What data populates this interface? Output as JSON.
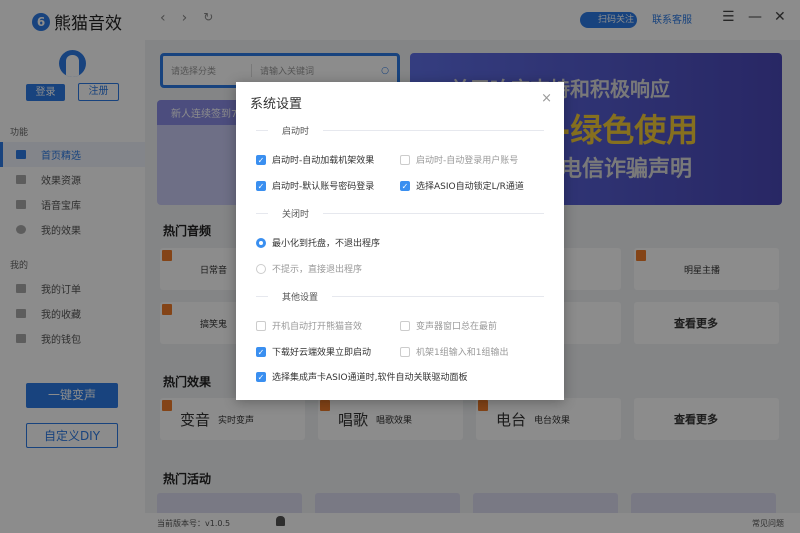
{
  "app": {
    "name": "熊猫音效",
    "logo_glyph": "6"
  },
  "topbar": {
    "back": "‹",
    "forward": "›",
    "refresh": "↻",
    "scan_follow": "扫码关注",
    "contact_service": "联系客服",
    "menu": "☰",
    "minimize": "—",
    "close": "✕"
  },
  "sidebar": {
    "login": "登录",
    "register": "注册",
    "group1": "功能",
    "items1": [
      {
        "label": "首页精选",
        "active": true
      },
      {
        "label": "效果资源"
      },
      {
        "label": "语音宝库"
      },
      {
        "label": "我的效果"
      }
    ],
    "group2": "我的",
    "items2": [
      {
        "label": "我的订单"
      },
      {
        "label": "我的收藏"
      },
      {
        "label": "我的钱包"
      }
    ],
    "one_click": "一键变声",
    "custom_diy": "自定义DIY"
  },
  "main": {
    "search": {
      "category_placeholder": "请选择分类",
      "keyword_placeholder": "请输入关键词"
    },
    "sign_banner": "新人连续签到7天",
    "banner": {
      "line1": "关于响应支持和积极响应",
      "line2": "网-绿色使用",
      "line3": "电信诈骗声明"
    },
    "sections": {
      "hot_audio": "热门音频",
      "hot_effects": "热门效果",
      "hot_activity": "热门活动"
    },
    "audio_cards": [
      "日常音",
      "明星主播",
      "搞笑鬼",
      "查看更多"
    ],
    "effect_cards": [
      {
        "big": "变音",
        "small": "实时变声"
      },
      {
        "big": "唱歌",
        "small": "唱歌效果"
      },
      {
        "big": "电台",
        "small": "电台效果"
      },
      {
        "big": "查看更多",
        "small": ""
      }
    ]
  },
  "footer": {
    "version": "当前版本号：v1.0.5",
    "faq": "常见问题"
  },
  "dialog": {
    "title": "系统设置",
    "close": "×",
    "sec_startup": "启动时",
    "sec_close": "关闭时",
    "sec_other": "其他设置",
    "startup": [
      {
        "label": "启动时-自动加载机架效果",
        "checked": true
      },
      {
        "label": "启动时-自动登录用户账号",
        "checked": false
      },
      {
        "label": "启动时-默认账号密码登录",
        "checked": true
      },
      {
        "label": "选择ASIO自动锁定L/R通道",
        "checked": true
      }
    ],
    "close_opts": [
      {
        "label": "最小化到托盘，不退出程序",
        "selected": true
      },
      {
        "label": "不提示，直接退出程序",
        "selected": false
      }
    ],
    "other": [
      {
        "label": "开机自动打开熊猫音效",
        "checked": false
      },
      {
        "label": "变声器窗口总在最前",
        "checked": false
      },
      {
        "label": "下载好云端效果立即启动",
        "checked": true
      },
      {
        "label": "机架1组输入和1组输出",
        "checked": false
      },
      {
        "label": "选择集成声卡ASIO通道时,软件自动关联驱动面板",
        "checked": true
      }
    ]
  }
}
